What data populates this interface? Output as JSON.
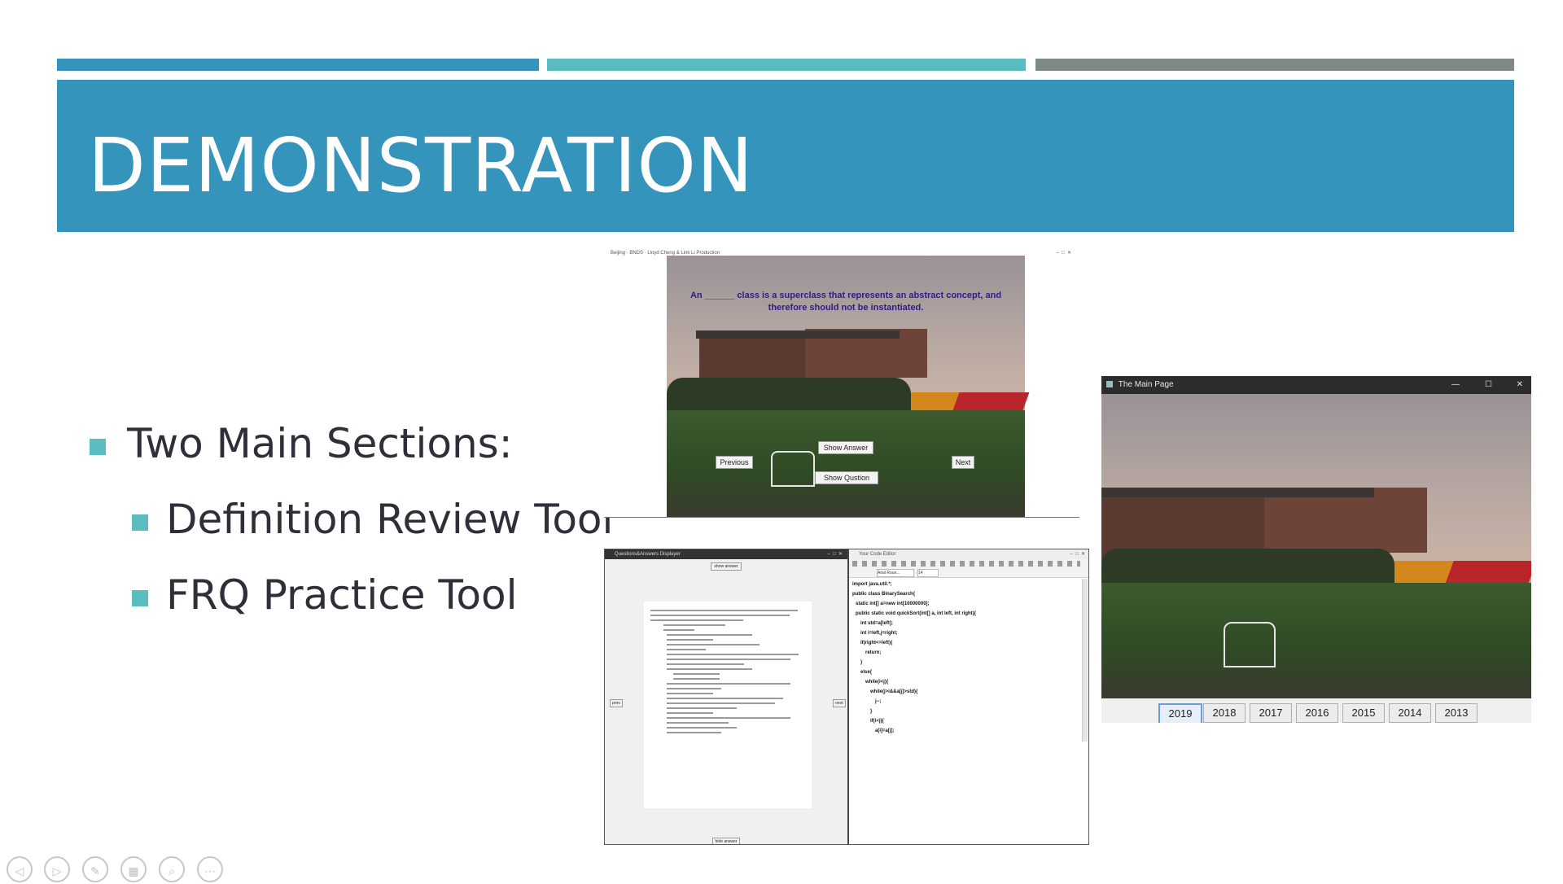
{
  "slide": {
    "title": "DEMONSTRATION",
    "bullets": [
      {
        "text": "Two Main Sections:",
        "level": 1
      },
      {
        "text": "Definition Review Tool",
        "level": 2
      },
      {
        "text": "FRQ Practice Tool",
        "level": 2
      }
    ],
    "colors": {
      "band": "#3494bb",
      "bar1": "#3494bb",
      "bar2": "#58bcc1",
      "bar3": "#7f898a",
      "bullet": "#5bbdc0"
    }
  },
  "review_window": {
    "title": "Beijing · BNDS · Lloyd Cheng & Link Li Production",
    "question": "An ______ class is a superclass that represents an abstract concept, and therefore should not be instantiated.",
    "buttons": {
      "show_answer": "Show Answer",
      "previous": "Previous",
      "next": "Next",
      "show_question": "Show Qustion"
    }
  },
  "qa_window": {
    "title": "Questions&Answers Displayer",
    "show_answer": "show answer",
    "hide_answer": "hide answer",
    "prev": "prev",
    "next": "next"
  },
  "editor_window": {
    "title": "Your Code Editor",
    "font": "Arial Roun...",
    "size": "14",
    "code": [
      "import java.util.*;",
      "public class BinarySearch{",
      "  static int[] a=new int[10000000];",
      "  public static void quickSort(int[] a, int left, int right){",
      "    int std=a[left];",
      "    int i=left,j=right;",
      "    if(right<=left){",
      "      return;",
      "    }",
      "    else{",
      "      while(i<j){",
      "        while(j>i&&a[j]>std){",
      "          j--;",
      "        }",
      "        if(i<j){",
      "          a[i]=a[j];"
    ]
  },
  "main_window": {
    "title": "The Main Page",
    "years": [
      "2019",
      "2018",
      "2017",
      "2016",
      "2015",
      "2014",
      "2013"
    ],
    "selected_year": "2019"
  },
  "controls": [
    "previous-slide-icon",
    "next-slide-icon",
    "pen-icon",
    "slides-grid-icon",
    "zoom-icon",
    "more-options-icon"
  ]
}
